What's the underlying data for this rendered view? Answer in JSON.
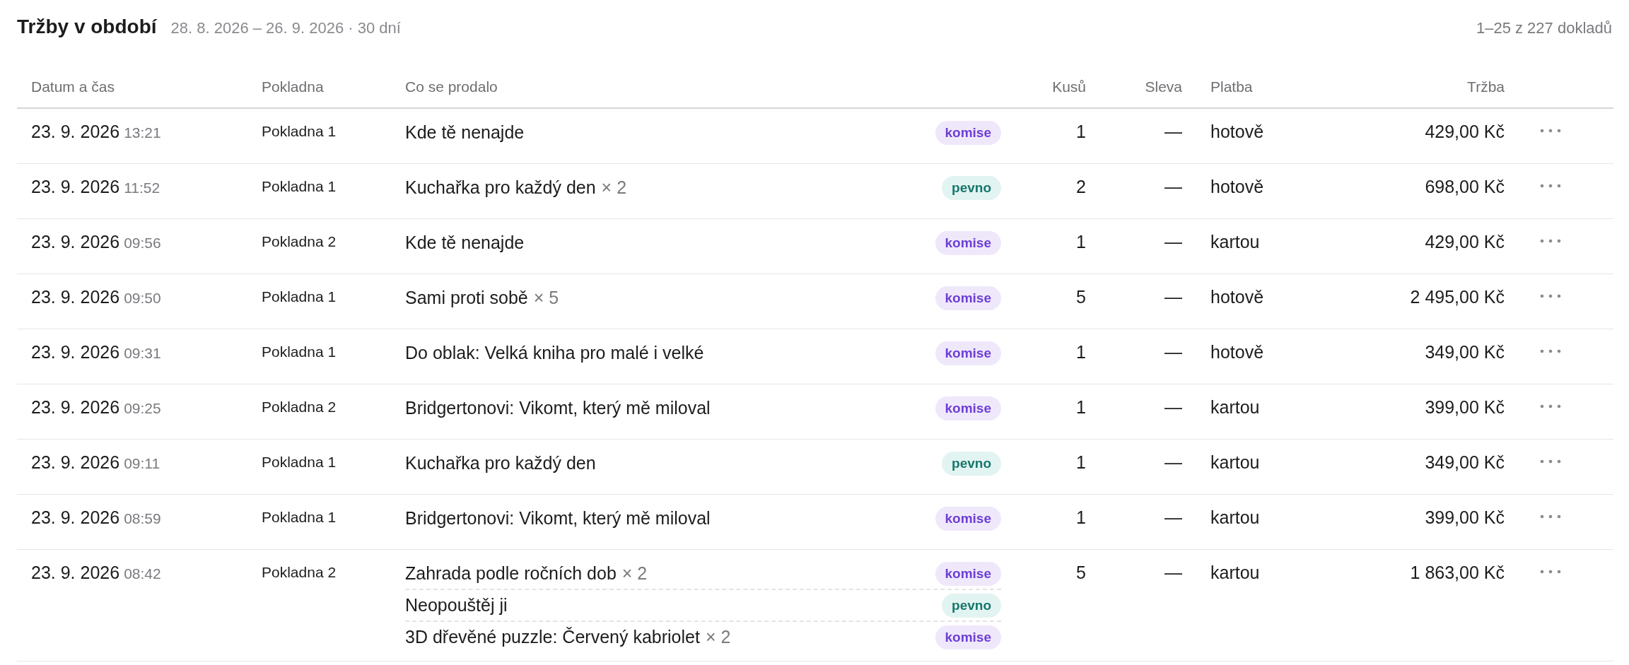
{
  "header": {
    "title": "Tržby v období",
    "period": "28. 8. 2026 – 26. 9. 2026 · 30 dní",
    "count": "1–25 z 227 dokladů"
  },
  "table": {
    "columns": [
      "Datum a čas",
      "Pokladna",
      "Co se prodalo",
      "Kusů",
      "Sleva",
      "Platba",
      "Tržba"
    ],
    "rows": [
      {
        "date": "23. 9. 2026",
        "time": "13:21",
        "register": "Pokladna 1",
        "items": [
          {
            "title": "Kde tě nenajde",
            "badge": {
              "label": "komise",
              "kind": "consignment"
            }
          }
        ],
        "pieces": "1",
        "discount": "—",
        "payment": "hotově",
        "revenue": "429,00 Kč"
      },
      {
        "date": "23. 9. 2026",
        "time": "11:52",
        "register": "Pokladna 1",
        "items": [
          {
            "title": "Kuchařka pro každý den",
            "quantity": "× 2",
            "badge": {
              "label": "pevno",
              "kind": "fixed"
            }
          }
        ],
        "pieces": "2",
        "discount": "—",
        "payment": "hotově",
        "revenue": "698,00 Kč"
      },
      {
        "date": "23. 9. 2026",
        "time": "09:56",
        "register": "Pokladna 2",
        "items": [
          {
            "title": "Kde tě nenajde",
            "badge": {
              "label": "komise",
              "kind": "consignment"
            }
          }
        ],
        "pieces": "1",
        "discount": "—",
        "payment": "kartou",
        "revenue": "429,00 Kč"
      },
      {
        "date": "23. 9. 2026",
        "time": "09:50",
        "register": "Pokladna 1",
        "items": [
          {
            "title": "Sami proti sobě",
            "quantity": "× 5",
            "badge": {
              "label": "komise",
              "kind": "consignment"
            }
          }
        ],
        "pieces": "5",
        "discount": "—",
        "payment": "hotově",
        "revenue": "2 495,00 Kč"
      },
      {
        "date": "23. 9. 2026",
        "time": "09:31",
        "register": "Pokladna 1",
        "items": [
          {
            "title": "Do oblak: Velká kniha pro malé i velké",
            "badge": {
              "label": "komise",
              "kind": "consignment"
            }
          }
        ],
        "pieces": "1",
        "discount": "—",
        "payment": "hotově",
        "revenue": "349,00 Kč"
      },
      {
        "date": "23. 9. 2026",
        "time": "09:25",
        "register": "Pokladna 2",
        "items": [
          {
            "title": "Bridgertonovi: Vikomt, který mě miloval",
            "badge": {
              "label": "komise",
              "kind": "consignment"
            }
          }
        ],
        "pieces": "1",
        "discount": "—",
        "payment": "kartou",
        "revenue": "399,00 Kč"
      },
      {
        "date": "23. 9. 2026",
        "time": "09:11",
        "register": "Pokladna 1",
        "items": [
          {
            "title": "Kuchařka pro každý den",
            "badge": {
              "label": "pevno",
              "kind": "fixed"
            }
          }
        ],
        "pieces": "1",
        "discount": "—",
        "payment": "kartou",
        "revenue": "349,00 Kč"
      },
      {
        "date": "23. 9. 2026",
        "time": "08:59",
        "register": "Pokladna 1",
        "items": [
          {
            "title": "Bridgertonovi: Vikomt, který mě miloval",
            "badge": {
              "label": "komise",
              "kind": "consignment"
            }
          }
        ],
        "pieces": "1",
        "discount": "—",
        "payment": "kartou",
        "revenue": "399,00 Kč"
      },
      {
        "date": "23. 9. 2026",
        "time": "08:42",
        "register": "Pokladna 2",
        "items": [
          {
            "title": "Zahrada podle ročních dob",
            "quantity": "× 2",
            "badge": {
              "label": "komise",
              "kind": "consignment"
            }
          },
          {
            "title": "Neopouštěj ji",
            "badge": {
              "label": "pevno",
              "kind": "fixed"
            }
          },
          {
            "title": "3D dřevěné puzzle: Červený kabriolet",
            "quantity": "× 2",
            "badge": {
              "label": "komise",
              "kind": "consignment"
            }
          }
        ],
        "pieces": "5",
        "discount": "—",
        "payment": "kartou",
        "revenue": "1 863,00 Kč"
      }
    ]
  }
}
